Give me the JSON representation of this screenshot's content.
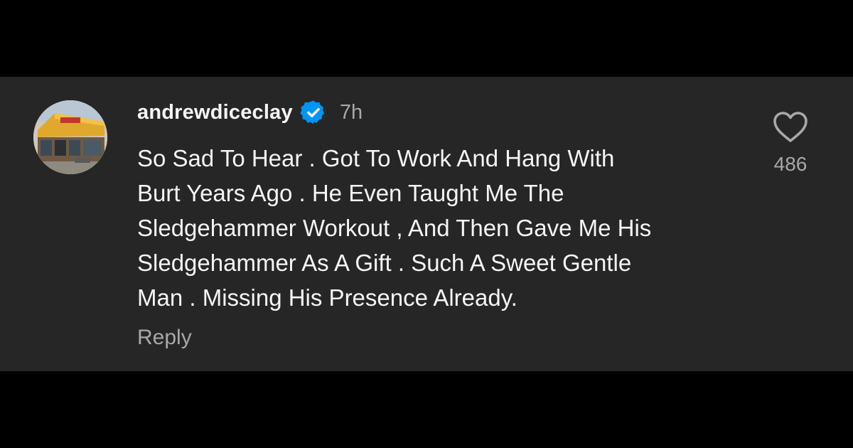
{
  "comment": {
    "username": "andrewdiceclay",
    "verified_icon": "verified-badge-icon",
    "timestamp": "7h",
    "text_lines": [
      "So Sad To Hear . Got To Work And Hang With",
      "Burt Years Ago . He Even Taught Me The",
      "Sledgehammer Workout , And Then Gave Me His",
      "Sledgehammer As A Gift . Such A Sweet Gentle",
      "Man . Missing His Presence Already."
    ],
    "reply_label": "Reply",
    "like_icon": "heart-outline-icon",
    "like_count": "486"
  },
  "colors": {
    "page_background": "#000000",
    "card_background": "#262626",
    "primary_text": "#f5f5f5",
    "secondary_text": "#a8a8a8",
    "verified_blue": "#0095f6"
  }
}
